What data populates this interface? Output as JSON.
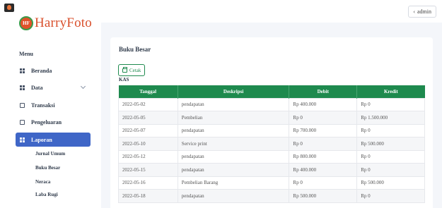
{
  "app": {
    "logo_badge": "HF",
    "logo_text": "HarryFoto",
    "user_label": "admin"
  },
  "sidebar": {
    "menu_title": "Menu",
    "items": [
      {
        "label": "Beranda"
      },
      {
        "label": "Data"
      },
      {
        "label": "Transaksi"
      },
      {
        "label": "Pengeluaran"
      },
      {
        "label": "Laporan"
      }
    ],
    "sub_items": [
      {
        "label": "Jurnal Umum"
      },
      {
        "label": "Buku Besar"
      },
      {
        "label": "Neraca"
      },
      {
        "label": "Laba Rugi"
      }
    ]
  },
  "main": {
    "title": "Buku Besar",
    "print_label": "Cetak",
    "section_label": "KAS",
    "table": {
      "headers": [
        "Tanggal",
        "Deskripsi",
        "Debit",
        "Kredit"
      ],
      "rows": [
        [
          "2022-05-02",
          "pendapatan",
          "Rp 400.000",
          "Rp 0"
        ],
        [
          "2022-05-05",
          "Pembelian",
          "Rp 0",
          "Rp 1.500.000"
        ],
        [
          "2022-05-07",
          "pendapatan",
          "Rp 700.000",
          "Rp 0"
        ],
        [
          "2022-05-10",
          "Service print",
          "Rp 0",
          "Rp 500.000"
        ],
        [
          "2022-05-12",
          "pendapatan",
          "Rp 800.000",
          "Rp 0"
        ],
        [
          "2022-05-15",
          "pendapatan",
          "Rp 400.000",
          "Rp 0"
        ],
        [
          "2022-05-16",
          "Pembelian Barang",
          "Rp 0",
          "Rp 500.000"
        ],
        [
          "2022-05-18",
          "pendapatan",
          "Rp 500.000",
          "Rp 0"
        ]
      ]
    }
  },
  "colors": {
    "accent_green": "#1e8a4e",
    "active_blue": "#3f66c7",
    "logo_orange": "#d9502c"
  }
}
